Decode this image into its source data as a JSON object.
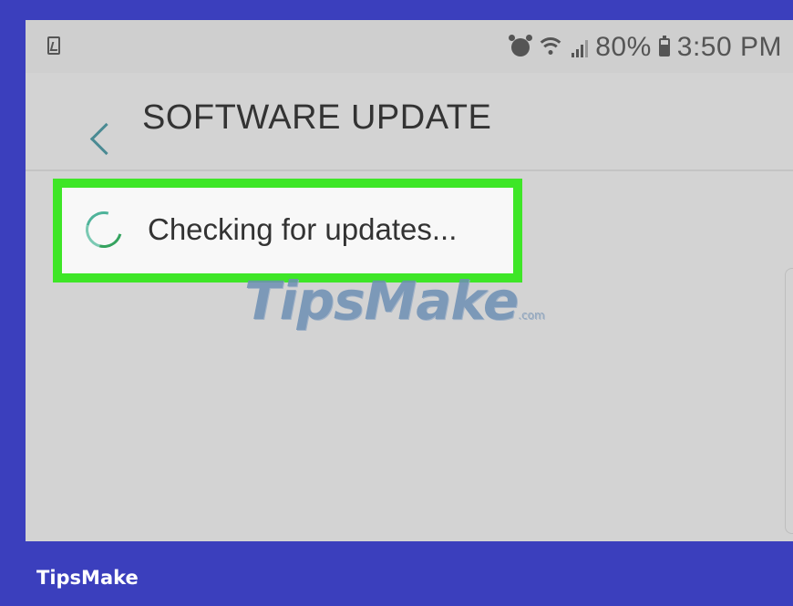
{
  "status_bar": {
    "battery_percent": "80%",
    "time": "3:50 PM",
    "icons": [
      "notification-icon",
      "alarm-icon",
      "wifi-icon",
      "signal-icon",
      "battery-icon"
    ]
  },
  "app_bar": {
    "title": "SOFTWARE UPDATE",
    "back_icon": "chevron-left-icon"
  },
  "content": {
    "progress_text": "Checking for updates...",
    "spinner_icon": "loading-spinner-icon"
  },
  "watermark": {
    "text": "TipsMake",
    "suffix": ".com"
  },
  "footer": {
    "brand": "TipsMake"
  },
  "colors": {
    "frame": "#3b3fbd",
    "highlight": "#3ee627",
    "accent": "#4a8a93",
    "screen_bg": "#d3d3d3"
  }
}
